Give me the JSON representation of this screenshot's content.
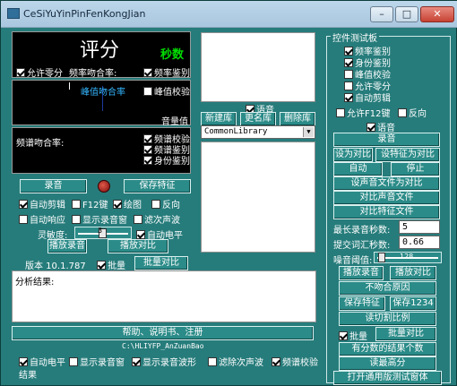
{
  "window": {
    "title": "CeSiYuYinPinFenKongJian",
    "controls": {
      "minimize": "–",
      "maximize": "□",
      "close": "✕"
    }
  },
  "score_panel": {
    "title": "评分",
    "seconds_label": "秒数",
    "allow_zero": "允许零分",
    "freq_rate_label": "频率吻合率:",
    "freq_identify": "频率鉴别"
  },
  "wave_panel": {
    "peak_rate": "峰值吻合率",
    "peak_check": "峰值校验",
    "volume": "音量值"
  },
  "spectrum_panel": {
    "rate_label": "频谱吻合率:",
    "spectrum_check": "频谱校验",
    "spectrum_identify": "频谱鉴别",
    "identity_identify": "身份鉴别"
  },
  "record": {
    "record_button": "录音",
    "save_feature_button": "保存特征"
  },
  "options": {
    "auto_cut": "自动剪辑",
    "f12_key": "F12键",
    "plot": "绘图",
    "reverse": "反向",
    "auto_respond": "自动响应",
    "show_record_screen": "显示录音窗",
    "reject_secondary": "滤次声波",
    "sensitivity_label": "灵敏度:",
    "sensitivity_value": "3",
    "auto_level": "自动电平",
    "play_record": "播放录音",
    "play_compare": "播放对比"
  },
  "version": {
    "label": "版本 10.1.787",
    "batch": "批量",
    "batch_compare": "批量对比"
  },
  "analysis": {
    "result_label": "分析结果:"
  },
  "help_button": "帮助、说明书、注册",
  "path": "C:\\HLIYFP_AnZuanBao",
  "bottom_options": {
    "auto_level": "自动电平",
    "show_record_screen": "显示录音窗",
    "show_waveform": "显示录音波形",
    "reject_secondary": "滤除次声波",
    "spectrum_check": "频谱校验",
    "result": "结果"
  },
  "library": {
    "voice": "语音",
    "new_lib": "新建库",
    "rename_lib": "更名库",
    "delete_lib": "删除库",
    "selected": "CommonLibrary"
  },
  "control_test": {
    "title": "控件测试板",
    "checks": {
      "freq_identify": "频率鉴别",
      "identity_identify": "身份鉴别",
      "peak_check": "峰值校验",
      "allow_zero": "允许零分",
      "auto_cut": "自动剪辑",
      "allow_f12": "允许F12键",
      "reverse": "反向",
      "voice": "语音"
    },
    "buttons": {
      "record": "录音",
      "set_compare": "设为对比",
      "set_feature_compare": "设特征为对比",
      "auto": "自动",
      "stop": "停止",
      "set_audio_file_compare": "设声音文件为对比",
      "compare_audio_file": "对比声音文件",
      "compare_feature_file": "对比特征文件",
      "play_record": "播放录音",
      "play_compare": "播放对比",
      "reason": "不吻合原因",
      "save_feature": "保存特征",
      "save_1234": "保存1234",
      "read_ratio": "读切割比例",
      "batch_compare": "批量对比",
      "best_results": "有分数的结果个数",
      "read_best": "读最高分",
      "open_test_window": "打开通用版测试窗体"
    },
    "max_seconds_label": "最长录音秒数:",
    "max_seconds_value": "5",
    "vocab_seconds_label": "提交词汇秒数:",
    "vocab_seconds_value": "0.66",
    "noise_label": "噪音阈值:",
    "noise_value": "128",
    "batch": "批量"
  }
}
